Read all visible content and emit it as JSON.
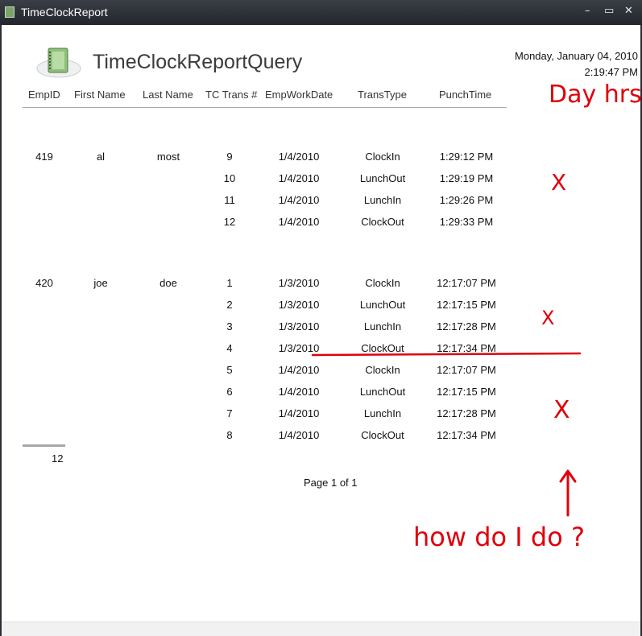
{
  "window": {
    "title": "TimeClockReport",
    "controls": {
      "minimize": "–",
      "maximize": "▭",
      "close": "✕"
    }
  },
  "report": {
    "title": "TimeClockReportQuery",
    "date": "Monday, January 04, 2010",
    "time": "2:19:47 PM",
    "icon": "notebook-icon",
    "columns": [
      "EmpID",
      "First Name",
      "Last Name",
      "TC Trans #",
      "EmpWorkDate",
      "TransType",
      "PunchTime"
    ],
    "groups": [
      {
        "emp_id": "419",
        "first_name": "al",
        "last_name": "most",
        "rows": [
          {
            "trans": "9",
            "date": "1/4/2010",
            "type": "ClockIn",
            "time": "1:29:12 PM"
          },
          {
            "trans": "10",
            "date": "1/4/2010",
            "type": "LunchOut",
            "time": "1:29:19 PM"
          },
          {
            "trans": "11",
            "date": "1/4/2010",
            "type": "LunchIn",
            "time": "1:29:26 PM"
          },
          {
            "trans": "12",
            "date": "1/4/2010",
            "type": "ClockOut",
            "time": "1:29:33 PM"
          }
        ]
      },
      {
        "emp_id": "420",
        "first_name": "joe",
        "last_name": "doe",
        "rows": [
          {
            "trans": "1",
            "date": "1/3/2010",
            "type": "ClockIn",
            "time": "12:17:07 PM"
          },
          {
            "trans": "2",
            "date": "1/3/2010",
            "type": "LunchOut",
            "time": "12:17:15 PM"
          },
          {
            "trans": "3",
            "date": "1/3/2010",
            "type": "LunchIn",
            "time": "12:17:28 PM"
          },
          {
            "trans": "4",
            "date": "1/3/2010",
            "type": "ClockOut",
            "time": "12:17:34 PM"
          },
          {
            "trans": "5",
            "date": "1/4/2010",
            "type": "ClockIn",
            "time": "12:17:07 PM"
          },
          {
            "trans": "6",
            "date": "1/4/2010",
            "type": "LunchOut",
            "time": "12:17:15 PM"
          },
          {
            "trans": "7",
            "date": "1/4/2010",
            "type": "LunchIn",
            "time": "12:17:28 PM"
          },
          {
            "trans": "8",
            "date": "1/4/2010",
            "type": "ClockOut",
            "time": "12:17:34 PM"
          }
        ]
      }
    ],
    "total_count": "12",
    "page": "Page 1 of 1"
  },
  "annotations": {
    "day_hrs": "Day hrs",
    "question": "how do I do ?",
    "marks": [
      "X",
      "X",
      "X"
    ],
    "ink_color": "#e0000b"
  }
}
